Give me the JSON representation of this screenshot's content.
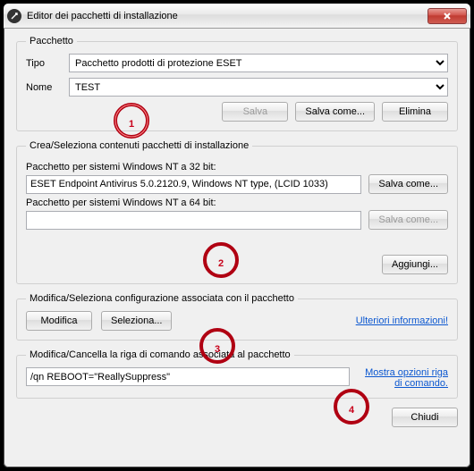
{
  "window": {
    "title": "Editor dei pacchetti di installazione"
  },
  "group1": {
    "legend": "Pacchetto",
    "tipo_label": "Tipo",
    "tipo_value": "Pacchetto prodotti di protezione ESET",
    "nome_label": "Nome",
    "nome_value": "TEST",
    "save": "Salva",
    "save_as": "Salva come...",
    "delete": "Elimina"
  },
  "group2": {
    "legend": "Crea/Seleziona contenuti pacchetti di installazione",
    "label32": "Pacchetto per sistemi Windows NT a 32 bit:",
    "value32": "ESET Endpoint Antivirus 5.0.2120.9, Windows NT type, (LCID 1033)",
    "save_as32": "Salva come...",
    "label64": "Pacchetto per sistemi Windows NT a 64 bit:",
    "value64": "",
    "save_as64": "Salva come...",
    "add": "Aggiungi..."
  },
  "group3": {
    "legend": "Modifica/Seleziona configurazione associata con il pacchetto",
    "modify": "Modifica",
    "select": "Seleziona...",
    "more_info": "Ulteriori informazioni!"
  },
  "group4": {
    "legend": "Modifica/Cancella la riga di comando associata al pacchetto",
    "cmd_value": "/qn REBOOT=\"ReallySuppress\"",
    "cmd_link": "Mostra opzioni riga di comando."
  },
  "footer": {
    "close": "Chiudi"
  },
  "markers": {
    "m1": "1",
    "m2": "2",
    "m3": "3",
    "m4": "4"
  }
}
